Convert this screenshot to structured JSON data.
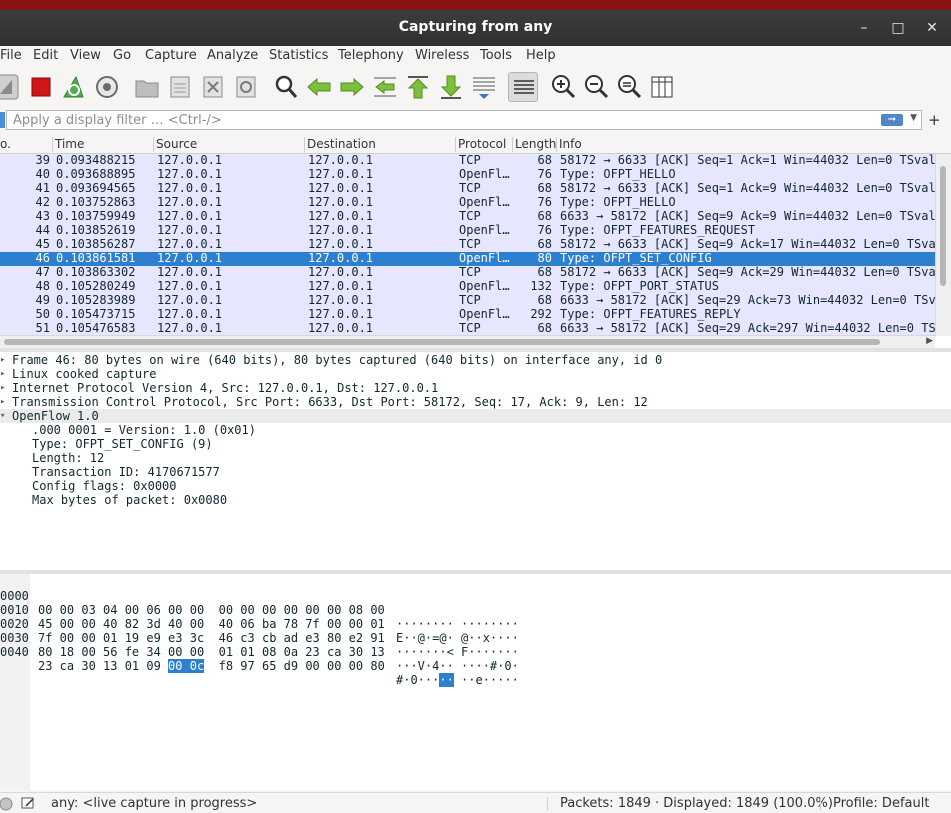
{
  "window": {
    "title": "Capturing from any"
  },
  "menu": [
    "File",
    "Edit",
    "View",
    "Go",
    "Capture",
    "Analyze",
    "Statistics",
    "Telephony",
    "Wireless",
    "Tools",
    "Help"
  ],
  "filter": {
    "placeholder": "Apply a display filter … <Ctrl-/>"
  },
  "packet_list": {
    "columns": [
      "o.",
      "Time",
      "Source",
      "Destination",
      "Protocol",
      "Length",
      "Info"
    ],
    "rows": [
      {
        "no": "39",
        "time": "0.093488215",
        "src": "127.0.0.1",
        "dst": "127.0.0.1",
        "proto": "TCP",
        "len": "68",
        "info": "58172 → 6633 [ACK] Seq=1 Ack=1 Win=44032 Len=0 TSval="
      },
      {
        "no": "40",
        "time": "0.093688895",
        "src": "127.0.0.1",
        "dst": "127.0.0.1",
        "proto": "OpenFl…",
        "len": "76",
        "info": "Type: OFPT_HELLO"
      },
      {
        "no": "41",
        "time": "0.093694565",
        "src": "127.0.0.1",
        "dst": "127.0.0.1",
        "proto": "TCP",
        "len": "68",
        "info": "58172 → 6633 [ACK] Seq=1 Ack=9 Win=44032 Len=0 TSval="
      },
      {
        "no": "42",
        "time": "0.103752863",
        "src": "127.0.0.1",
        "dst": "127.0.0.1",
        "proto": "OpenFl…",
        "len": "76",
        "info": "Type: OFPT_HELLO"
      },
      {
        "no": "43",
        "time": "0.103759949",
        "src": "127.0.0.1",
        "dst": "127.0.0.1",
        "proto": "TCP",
        "len": "68",
        "info": "6633 → 58172 [ACK] Seq=9 Ack=9 Win=44032 Len=0 TSval="
      },
      {
        "no": "44",
        "time": "0.103852619",
        "src": "127.0.0.1",
        "dst": "127.0.0.1",
        "proto": "OpenFl…",
        "len": "76",
        "info": "Type: OFPT_FEATURES_REQUEST"
      },
      {
        "no": "45",
        "time": "0.103856287",
        "src": "127.0.0.1",
        "dst": "127.0.0.1",
        "proto": "TCP",
        "len": "68",
        "info": "58172 → 6633 [ACK] Seq=9 Ack=17 Win=44032 Len=0 TSval"
      },
      {
        "no": "46",
        "time": "0.103861581",
        "src": "127.0.0.1",
        "dst": "127.0.0.1",
        "proto": "OpenFl…",
        "len": "80",
        "info": "Type: OFPT_SET_CONFIG",
        "selected": true
      },
      {
        "no": "47",
        "time": "0.103863302",
        "src": "127.0.0.1",
        "dst": "127.0.0.1",
        "proto": "TCP",
        "len": "68",
        "info": "58172 → 6633 [ACK] Seq=9 Ack=29 Win=44032 Len=0 TSval"
      },
      {
        "no": "48",
        "time": "0.105280249",
        "src": "127.0.0.1",
        "dst": "127.0.0.1",
        "proto": "OpenFl…",
        "len": "132",
        "info": "Type: OFPT_PORT_STATUS"
      },
      {
        "no": "49",
        "time": "0.105283989",
        "src": "127.0.0.1",
        "dst": "127.0.0.1",
        "proto": "TCP",
        "len": "68",
        "info": "6633 → 58172 [ACK] Seq=29 Ack=73 Win=44032 Len=0 TSva"
      },
      {
        "no": "50",
        "time": "0.105473715",
        "src": "127.0.0.1",
        "dst": "127.0.0.1",
        "proto": "OpenFl…",
        "len": "292",
        "info": "Type: OFPT_FEATURES_REPLY"
      },
      {
        "no": "51",
        "time": "0.105476583",
        "src": "127.0.0.1",
        "dst": "127.0.0.1",
        "proto": "TCP",
        "len": "68",
        "info": "6633 → 58172 [ACK] Seq=29 Ack=297 Win=44032 Len=0 TS"
      }
    ]
  },
  "details": [
    "Frame 46: 80 bytes on wire (640 bits), 80 bytes captured (640 bits) on interface any, id 0",
    "Linux cooked capture",
    "Internet Protocol Version 4, Src: 127.0.0.1, Dst: 127.0.0.1",
    "Transmission Control Protocol, Src Port: 6633, Dst Port: 58172, Seq: 17, Ack: 9, Len: 12",
    "OpenFlow 1.0",
    ".000 0001 = Version: 1.0 (0x01)",
    "Type: OFPT_SET_CONFIG (9)",
    "Length: 12",
    "Transaction ID: 4170671577",
    "Config flags: 0x0000",
    "Max bytes of packet: 0x0080"
  ],
  "hex": [
    {
      "off": "0000",
      "a": "00 00 03 04 00 06 00 00  00 00 00 00 00 00 08 00",
      "b": "",
      "c": "",
      "ascii": "········ ········",
      "ascii_sel": "",
      "ascii_post": ""
    },
    {
      "off": "0010",
      "a": "45 00 00 40 82 3d 40 00  40 06 ba 78 7f 00 00 01",
      "b": "",
      "c": "",
      "ascii": "E··@·=@· @··x····",
      "ascii_sel": "",
      "ascii_post": ""
    },
    {
      "off": "0020",
      "a": "7f 00 00 01 19 e9 e3 3c  46 c3 cb ad e3 80 e2 91",
      "b": "",
      "c": "",
      "ascii": "·······< F·······",
      "ascii_sel": "",
      "ascii_post": ""
    },
    {
      "off": "0030",
      "a": "80 18 00 56 fe 34 00 00  01 01 08 0a 23 ca 30 13",
      "b": "",
      "c": "",
      "ascii": "···V·4·· ····#·0·",
      "ascii_sel": "",
      "ascii_post": ""
    },
    {
      "off": "0040",
      "a": "23 ca 30 13 01 09 ",
      "b": "00 0c",
      "c": "  f8 97 65 d9 00 00 00 80",
      "ascii": "#·0···",
      "ascii_sel": "··",
      "ascii_post": " ··e·····"
    }
  ],
  "status": {
    "message": "any: <live capture in progress>",
    "packets": "Packets: 1849 · Displayed: 1849 (100.0%)",
    "profile": "Profile: Default"
  }
}
